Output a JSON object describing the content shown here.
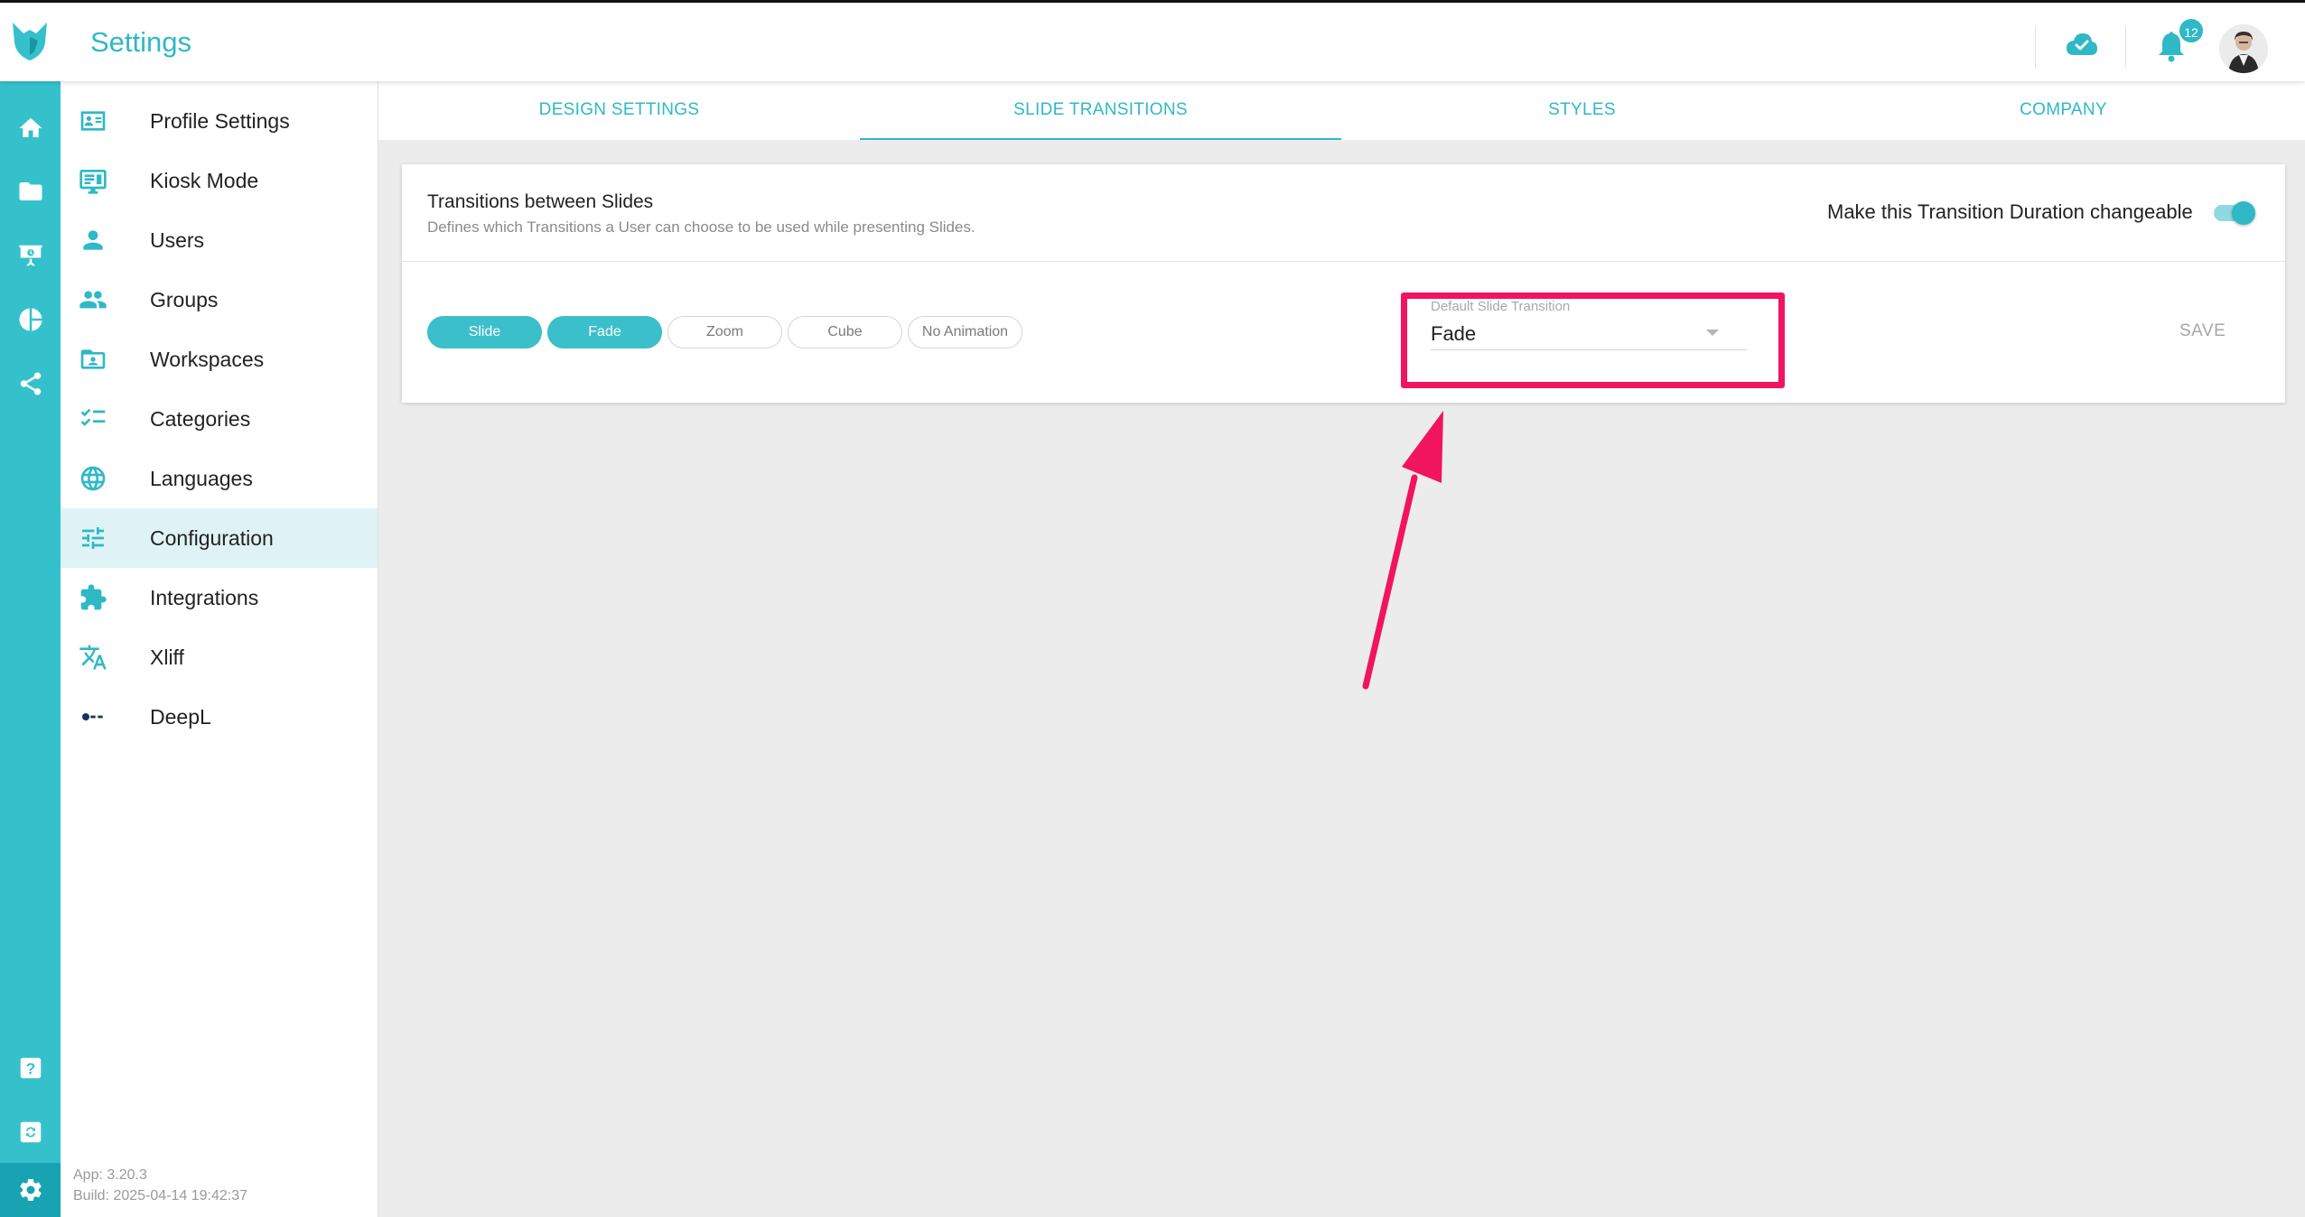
{
  "header": {
    "title": "Settings",
    "notification_count": "12"
  },
  "rail": {
    "items": [
      "home-icon",
      "folder-icon",
      "presentation-icon",
      "pie-chart-icon",
      "share-icon",
      "help-icon",
      "sync-icon",
      "settings-icon"
    ],
    "active": "settings-icon"
  },
  "sidebar": {
    "items": [
      {
        "label": "Profile Settings",
        "icon": "profile-card-icon"
      },
      {
        "label": "Kiosk Mode",
        "icon": "monitor-icon"
      },
      {
        "label": "Users",
        "icon": "user-icon"
      },
      {
        "label": "Groups",
        "icon": "group-icon"
      },
      {
        "label": "Workspaces",
        "icon": "workspace-folder-icon"
      },
      {
        "label": "Categories",
        "icon": "checklist-icon"
      },
      {
        "label": "Languages",
        "icon": "globe-icon"
      },
      {
        "label": "Configuration",
        "icon": "sliders-icon"
      },
      {
        "label": "Integrations",
        "icon": "puzzle-icon"
      },
      {
        "label": "Xliff",
        "icon": "translate-icon"
      },
      {
        "label": "DeepL",
        "icon": "deepl-icon"
      }
    ],
    "active_index": 7,
    "version_app": "App: 3.20.3",
    "version_build": "Build: 2025-04-14 19:42:37"
  },
  "tabs": {
    "items": [
      "DESIGN SETTINGS",
      "SLIDE TRANSITIONS",
      "STYLES",
      "COMPANY"
    ],
    "active_index": 1
  },
  "card": {
    "title": "Transitions between Slides",
    "subtitle": "Defines which Transitions a User can choose to be used while presenting Slides.",
    "toggle_label": "Make this Transition Duration changeable",
    "toggle_on": true,
    "chips": [
      {
        "label": "Slide",
        "selected": true
      },
      {
        "label": "Fade",
        "selected": true
      },
      {
        "label": "Zoom",
        "selected": false
      },
      {
        "label": "Cube",
        "selected": false
      },
      {
        "label": "No Animation",
        "selected": false
      }
    ],
    "select": {
      "label": "Default Slide Transition",
      "value": "Fade"
    },
    "save_label": "SAVE"
  },
  "colors": {
    "accent": "#2fb8c6",
    "rail": "#35c1cc",
    "annotation": "#f1145e",
    "background": "#ececec"
  }
}
